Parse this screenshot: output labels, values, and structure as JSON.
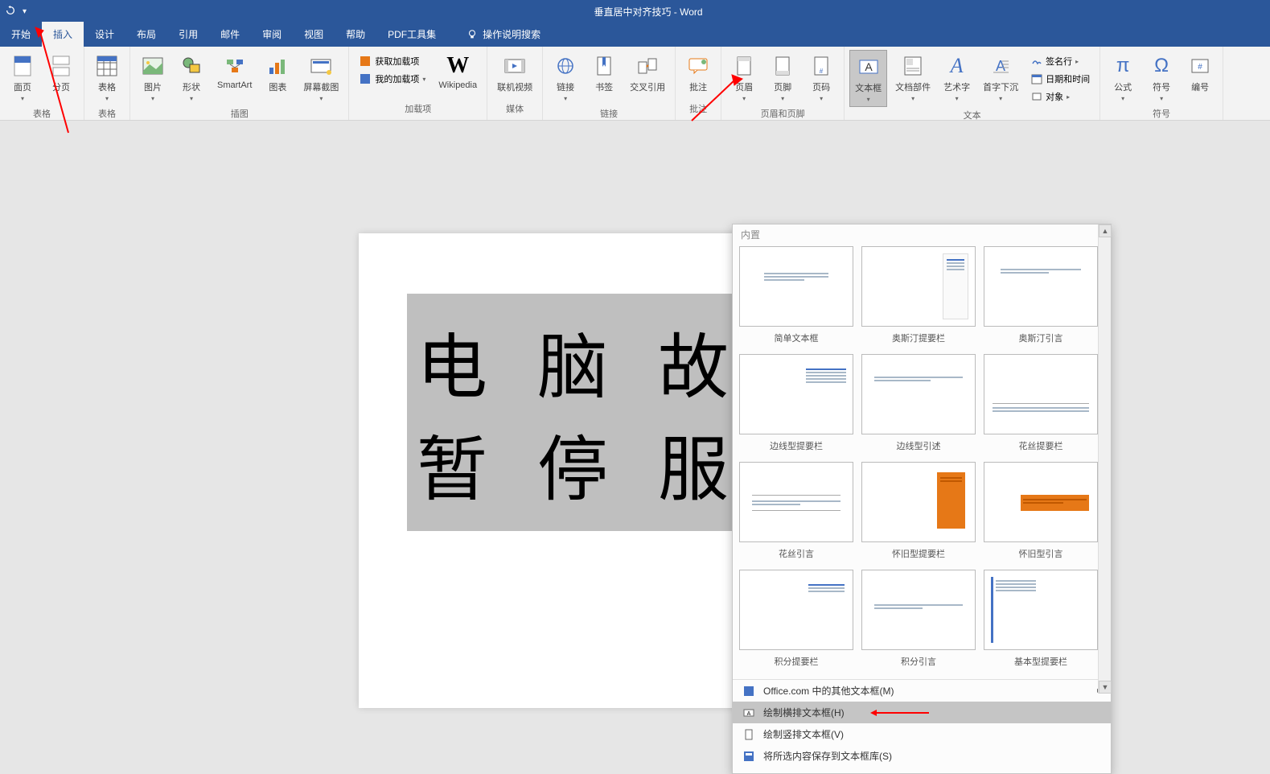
{
  "title": "垂直居中对齐技巧 - Word",
  "tabs": {
    "start": "开始",
    "insert": "插入",
    "design": "设计",
    "layout": "布局",
    "references": "引用",
    "mailings": "邮件",
    "review": "审阅",
    "view": "视图",
    "help": "帮助",
    "pdf": "PDF工具集",
    "tellme": "操作说明搜索"
  },
  "ribbon": {
    "pages": {
      "cover": "面页",
      "blank": "分页",
      "group": "表格"
    },
    "table": {
      "btn": "表格"
    },
    "illustrations": {
      "pictures": "图片",
      "shapes": "形状",
      "smartart": "SmartArt",
      "chart": "图表",
      "screenshot": "屏幕截图",
      "group": "插图"
    },
    "addins": {
      "get": "获取加载项",
      "my": "我的加载项",
      "wikipedia": "Wikipedia",
      "group": "加载项"
    },
    "media": {
      "onlinevideo": "联机视频",
      "group": "媒体"
    },
    "links": {
      "link": "链接",
      "bookmark": "书签",
      "crossref": "交叉引用",
      "group": "链接"
    },
    "comment": {
      "btn": "批注",
      "group": "批注"
    },
    "headerfooter": {
      "header": "页眉",
      "footer": "页脚",
      "pagenum": "页码",
      "group": "页眉和页脚"
    },
    "text": {
      "textbox": "文本框",
      "quickparts": "文档部件",
      "wordart": "艺术字",
      "dropcap": "首字下沉",
      "signature": "签名行",
      "datetime": "日期和时间",
      "object": "对象",
      "group": "文本"
    },
    "symbols": {
      "equation": "公式",
      "symbol": "符号",
      "number": "编号",
      "group": "符号"
    }
  },
  "document": {
    "line1": "电 脑 故 障",
    "line2": "暂 停 服 务"
  },
  "gallery": {
    "header": "内置",
    "items": [
      {
        "caption": "简单文本框"
      },
      {
        "caption": "奥斯汀提要栏"
      },
      {
        "caption": "奥斯汀引言"
      },
      {
        "caption": "边线型提要栏"
      },
      {
        "caption": "边线型引述"
      },
      {
        "caption": "花丝提要栏"
      },
      {
        "caption": "花丝引言"
      },
      {
        "caption": "怀旧型提要栏"
      },
      {
        "caption": "怀旧型引言"
      },
      {
        "caption": "积分提要栏"
      },
      {
        "caption": "积分引言"
      },
      {
        "caption": "基本型提要栏"
      }
    ],
    "menu": {
      "office": "Office.com 中的其他文本框(M)",
      "horizontal": "绘制横排文本框(H)",
      "vertical": "绘制竖排文本框(V)",
      "save": "将所选内容保存到文本框库(S)"
    }
  }
}
